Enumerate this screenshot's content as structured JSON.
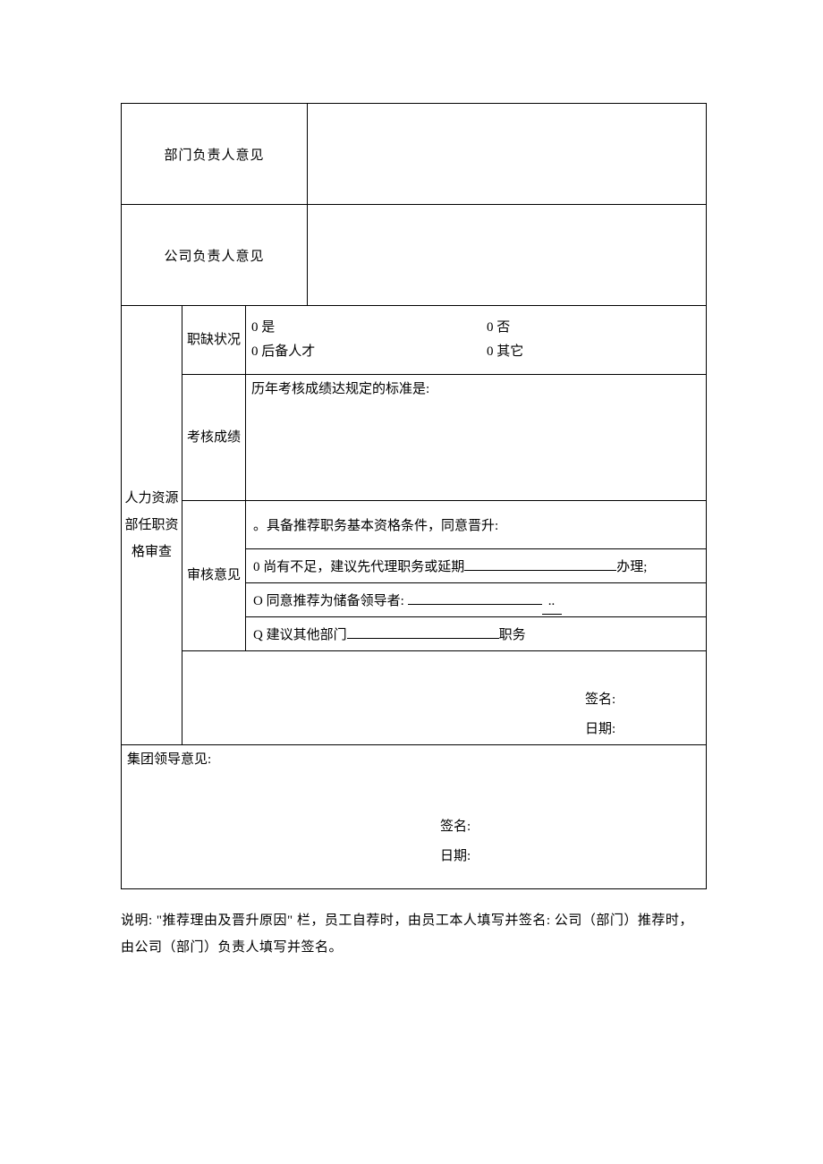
{
  "rows": {
    "dept_head": "部门负责人意见",
    "company_head": "公司负责人意见",
    "hr_title_l1": "人力资源",
    "hr_title_l2": "部任职资",
    "hr_title_l3": "格审查",
    "vacancy": "职缺状况",
    "vacancy_opt_yes": "0 是",
    "vacancy_opt_no": "0 否",
    "vacancy_opt_reserve": "0 后备人才",
    "vacancy_opt_other": "0 其它",
    "exam": "考核成绩",
    "exam_text": "历年考核成绩达规定的标准是:",
    "audit": "审核意见",
    "audit_line1": "。具备推荐职务基本资格条件，同意晋升:",
    "audit_line2_a": "0 尚有不足，建议先代理职务或延期",
    "audit_line2_b": "办理;",
    "audit_line3": "O 同意推荐为储备领导者:",
    "audit_line4_a": "Q 建议其他部门",
    "audit_line4_b": "职务",
    "sign_label": "签名:",
    "date_label": "日期:",
    "group_leader": "集团领导意见:"
  },
  "note": "说明:  \"推荐理由及晋升原因\" 栏，员工自荐时，由员工本人填写并签名: 公司（部门）推荐时，由公司（部门）负责人填写并签名。"
}
